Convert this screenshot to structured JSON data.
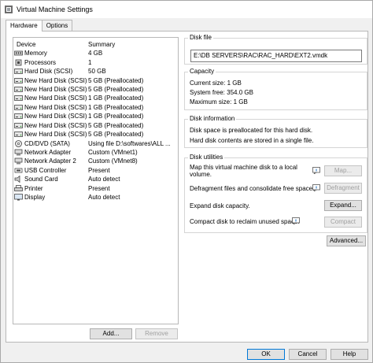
{
  "window": {
    "title": "Virtual Machine Settings"
  },
  "tabs": [
    {
      "label": "Hardware"
    },
    {
      "label": "Options"
    }
  ],
  "device_list": {
    "headers": {
      "device": "Device",
      "summary": "Summary"
    },
    "rows": [
      {
        "device": "Memory",
        "summary": "4 GB",
        "icon": "memory-icon"
      },
      {
        "device": "Processors",
        "summary": "1",
        "icon": "processor-icon"
      },
      {
        "device": "Hard Disk (SCSI)",
        "summary": "50 GB",
        "icon": "hard-disk-icon"
      },
      {
        "device": "New Hard Disk (SCSI)",
        "summary": "5 GB (Preallocated)",
        "icon": "hard-disk-icon"
      },
      {
        "device": "New Hard Disk (SCSI)",
        "summary": "5 GB (Preallocated)",
        "icon": "hard-disk-icon"
      },
      {
        "device": "New Hard Disk (SCSI)",
        "summary": "1 GB (Preallocated)",
        "icon": "hard-disk-icon"
      },
      {
        "device": "New Hard Disk (SCSI)",
        "summary": "1 GB (Preallocated)",
        "icon": "hard-disk-icon"
      },
      {
        "device": "New Hard Disk (SCSI)",
        "summary": "1 GB (Preallocated)",
        "icon": "hard-disk-icon"
      },
      {
        "device": "New Hard Disk (SCSI)",
        "summary": "5 GB (Preallocated)",
        "icon": "hard-disk-icon"
      },
      {
        "device": "New Hard Disk (SCSI)",
        "summary": "5 GB (Preallocated)",
        "icon": "hard-disk-icon"
      },
      {
        "device": "CD/DVD (SATA)",
        "summary": "Using file D:\\softwares\\ALL ...",
        "icon": "cd-dvd-icon"
      },
      {
        "device": "Network Adapter",
        "summary": "Custom (VMnet1)",
        "icon": "network-adapter-icon"
      },
      {
        "device": "Network Adapter 2",
        "summary": "Custom (VMnet8)",
        "icon": "network-adapter-icon"
      },
      {
        "device": "USB Controller",
        "summary": "Present",
        "icon": "usb-icon"
      },
      {
        "device": "Sound Card",
        "summary": "Auto detect",
        "icon": "sound-card-icon"
      },
      {
        "device": "Printer",
        "summary": "Present",
        "icon": "printer-icon"
      },
      {
        "device": "Display",
        "summary": "Auto detect",
        "icon": "display-icon"
      }
    ],
    "add_label": "Add...",
    "remove_label": "Remove"
  },
  "disk_file": {
    "title": "Disk file",
    "path": "E:\\DB SERVERS\\RAC\\RAC_HARD\\EXT2.vmdk"
  },
  "capacity": {
    "title": "Capacity",
    "current_size": "Current size: 1 GB",
    "system_free": "System free: 354.0 GB",
    "maximum_size": "Maximum size: 1 GB"
  },
  "disk_information": {
    "title": "Disk information",
    "line1": "Disk space is preallocated for this hard disk.",
    "line2": "Hard disk contents are stored in a single file."
  },
  "disk_utilities": {
    "title": "Disk utilities",
    "map_text_1": "Map this virtual machine disk to a local",
    "map_text_2": "volume.",
    "map_label": "Map...",
    "defrag_text": "Defragment files and consolidate free space.",
    "defrag_label": "Defragment",
    "expand_text": "Expand disk capacity.",
    "expand_label": "Expand...",
    "compact_text": "Compact disk to reclaim unused space.",
    "compact_label": "Compact"
  },
  "advanced_label": "Advanced...",
  "footer": {
    "ok_label": "OK",
    "cancel_label": "Cancel",
    "help_label": "Help"
  },
  "colors": {
    "window_bg": "#f0f0f0",
    "panel_bg": "#ffffff",
    "button_bg": "#e1e1e1",
    "default_button_border": "#0078d7"
  }
}
